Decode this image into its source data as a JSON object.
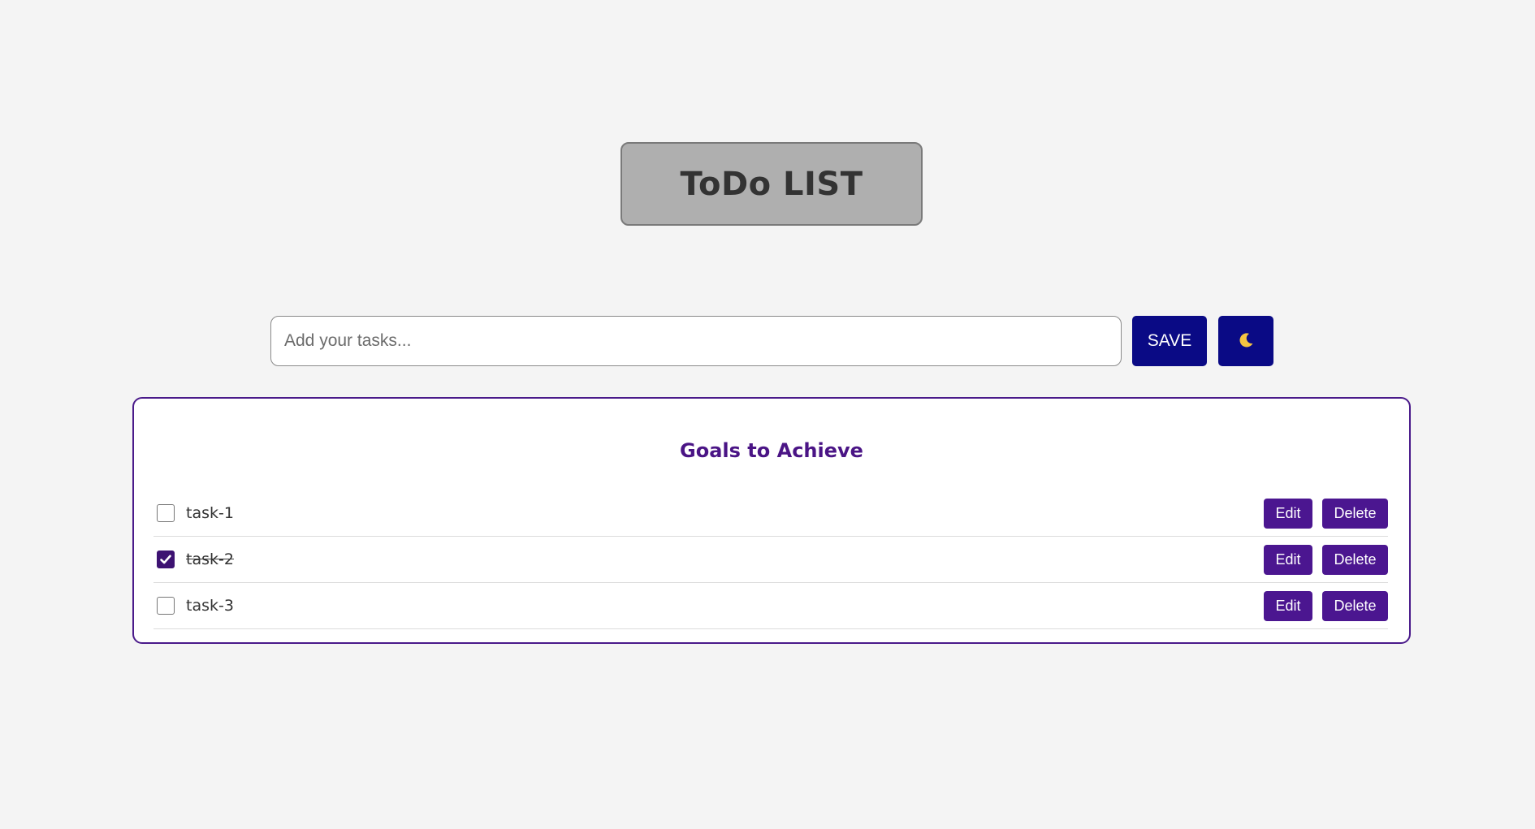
{
  "header": {
    "title": "ToDo LIST"
  },
  "input_bar": {
    "placeholder": "Add your tasks...",
    "value": "",
    "save_label": "SAVE",
    "theme_icon": "moon-icon"
  },
  "goals": {
    "heading": "Goals to Achieve",
    "edit_label": "Edit",
    "delete_label": "Delete",
    "tasks": [
      {
        "label": "task-1",
        "completed": false
      },
      {
        "label": "task-2",
        "completed": true
      },
      {
        "label": "task-3",
        "completed": false
      }
    ]
  },
  "colors": {
    "page_background": "#f4f4f4",
    "title_box": "#afafaf",
    "primary_button": "#0a0a85",
    "accent_purple": "#4b1690",
    "card_border": "#4a1a8a",
    "checkbox_checked": "#3d1272",
    "moon": "#f5c542"
  }
}
